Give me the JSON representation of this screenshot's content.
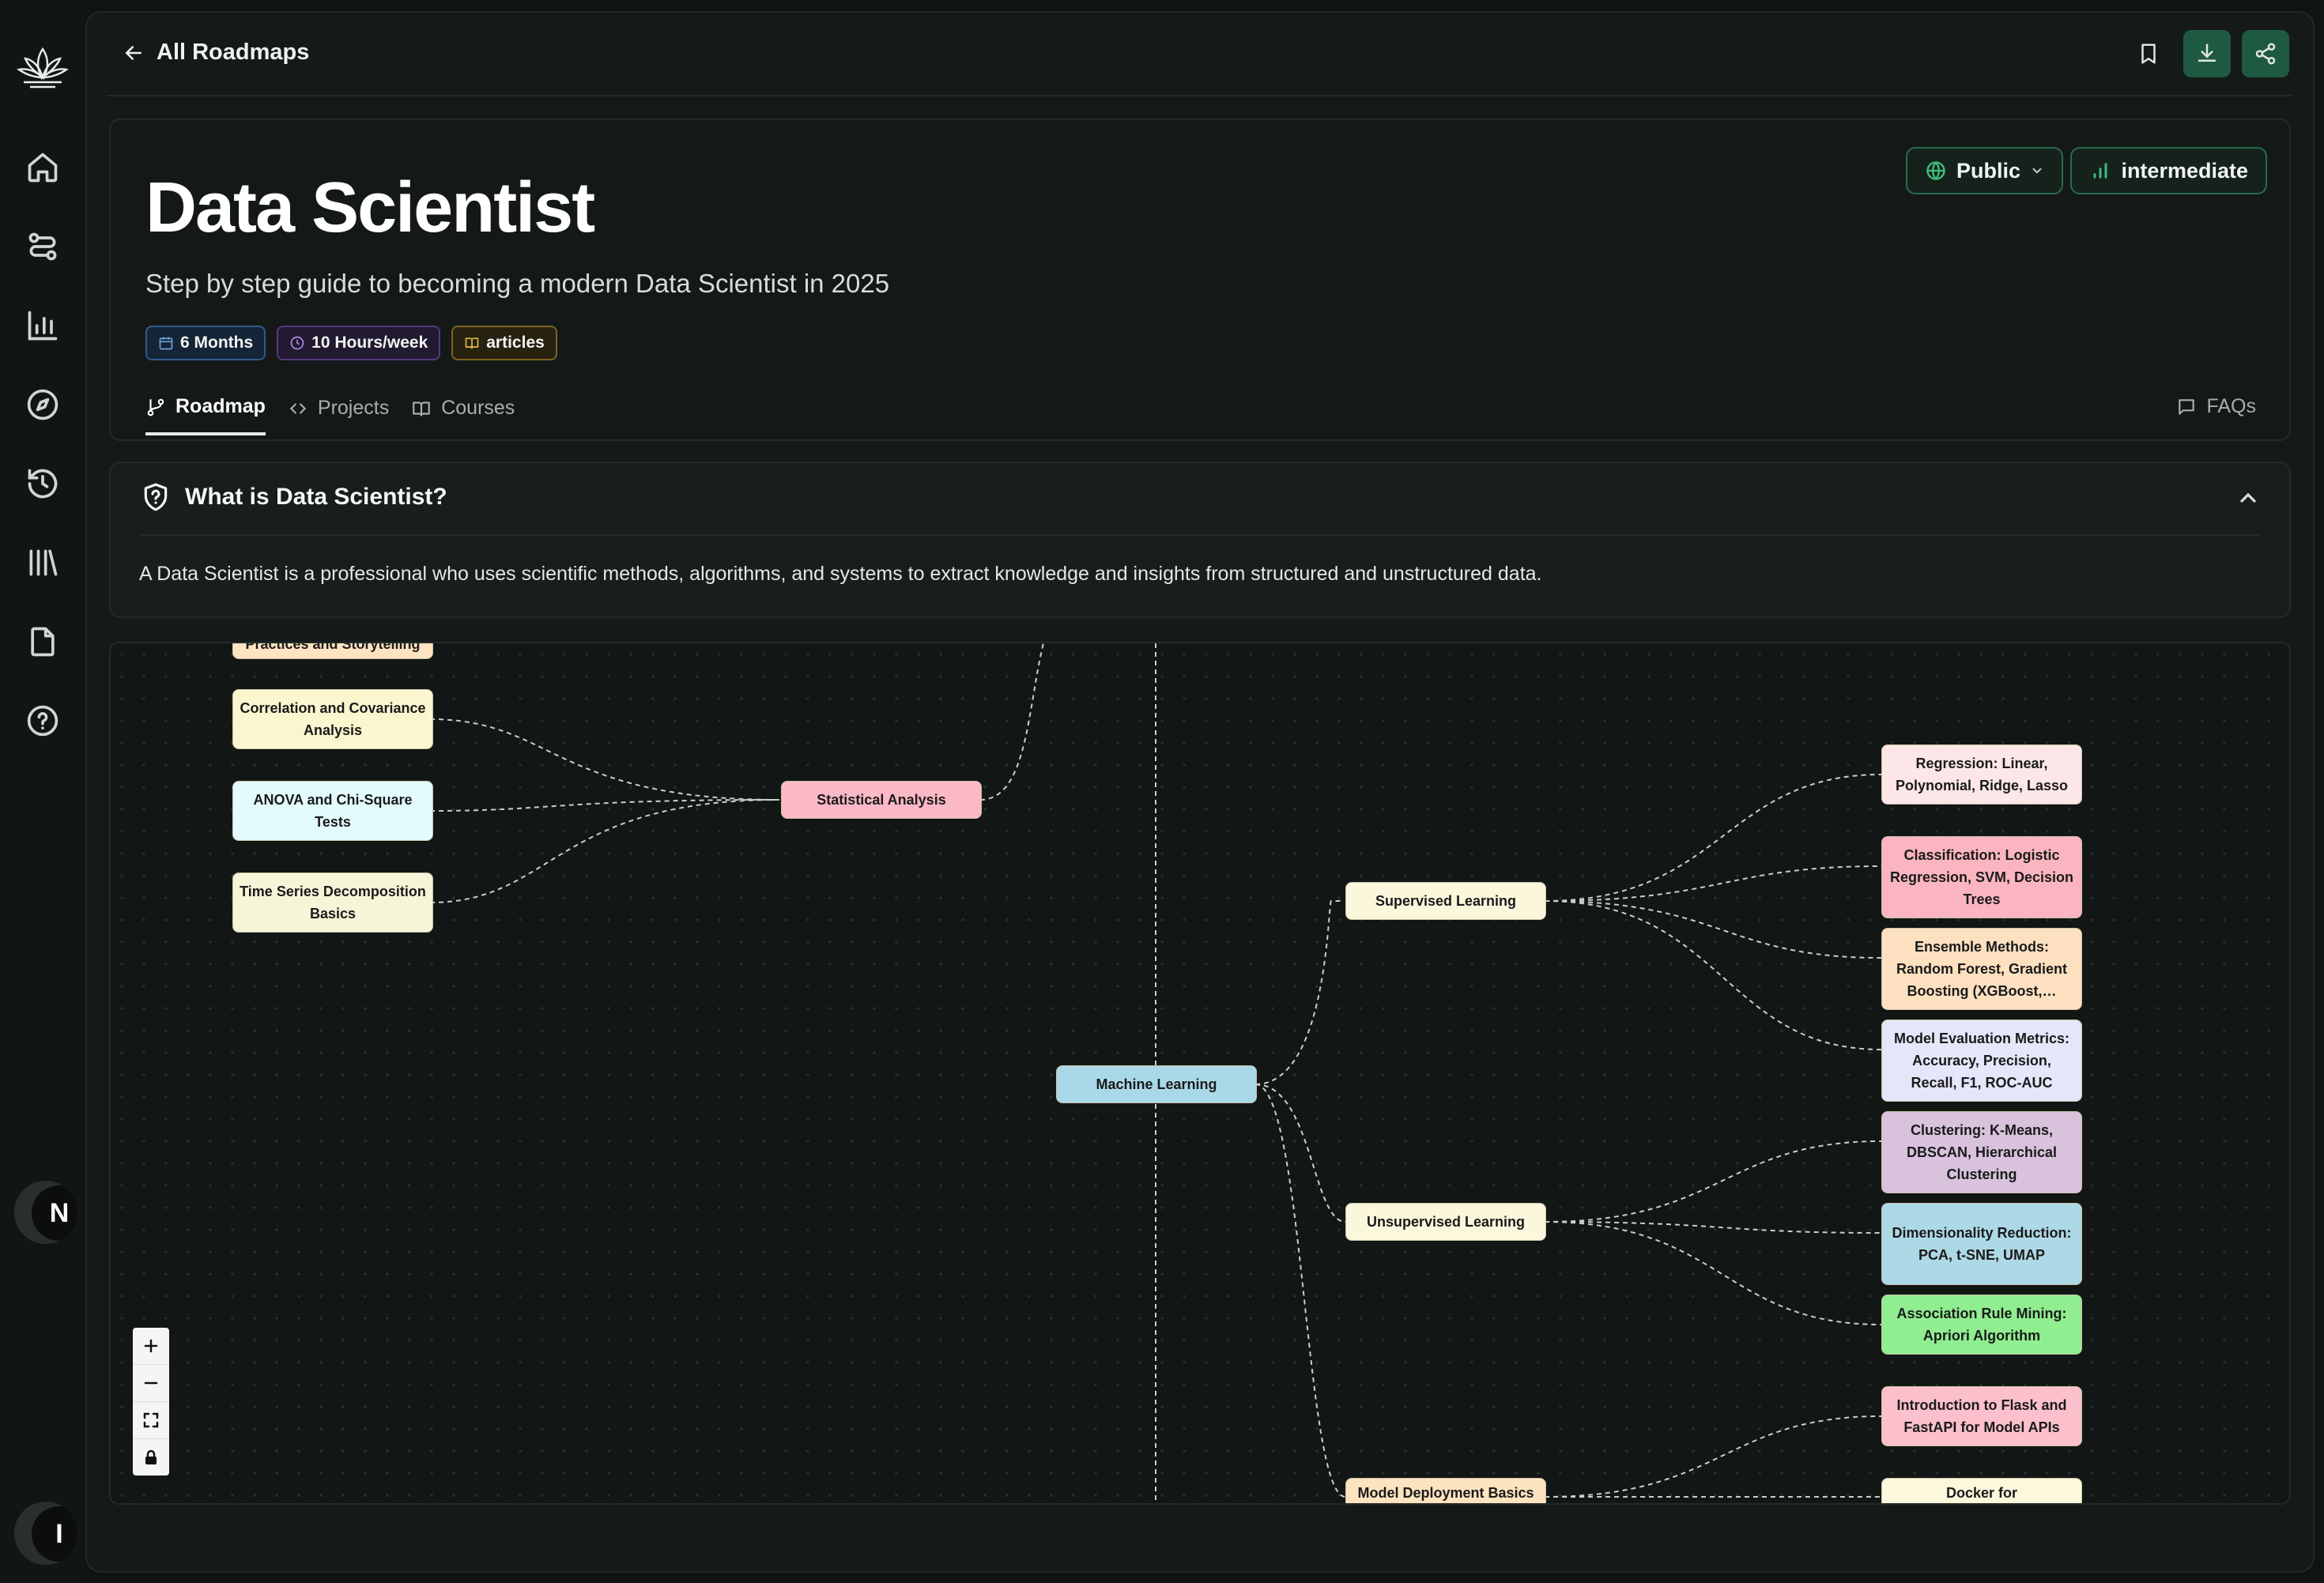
{
  "nav": {
    "back_label": "All Roadmaps",
    "sidebar_icons": [
      "lotus-logo-icon",
      "home-icon",
      "route-icon",
      "bar-chart-icon",
      "compass-icon",
      "history-icon",
      "library-icon",
      "file-icon",
      "help-icon"
    ],
    "avatar_initial_1": "N",
    "avatar_initial_2": "I"
  },
  "header": {
    "title": "Data Scientist",
    "subtitle": "Step by step guide to becoming a modern Data Scientist in 2025",
    "badges": {
      "duration": "6 Months",
      "hours": "10 Hours/week",
      "resource": "articles"
    },
    "visibility": "Public",
    "level": "intermediate"
  },
  "tabs": {
    "roadmap": "Roadmap",
    "projects": "Projects",
    "courses": "Courses",
    "faqs": "FAQs"
  },
  "whatis": {
    "title": "What is Data Scientist?",
    "body": "A Data Scientist is a professional who uses scientific methods, algorithms, and systems to extract knowledge and insights from structured and unstructured data."
  },
  "graph": {
    "nodes": {
      "storytelling": "Practices and Storytelling",
      "correlation": "Correlation and Covariance Analysis",
      "anova": "ANOVA and Chi-Square Tests",
      "timeseries": "Time Series Decomposition Basics",
      "statistical": "Statistical Analysis",
      "ml": "Machine Learning",
      "supervised": "Supervised Learning",
      "unsupervised": "Unsupervised Learning",
      "deployment": "Model Deployment Basics",
      "regression": "Regression: Linear, Polynomial, Ridge, Lasso",
      "classification": "Classification: Logistic Regression, SVM, Decision Trees",
      "ensemble": "Ensemble Methods: Random Forest, Gradient Boosting (XGBoost,…",
      "evaluation": "Model Evaluation Metrics: Accuracy, Precision, Recall, F1, ROC-AUC",
      "clustering": "Clustering: K-Means, DBSCAN, Hierarchical Clustering",
      "dimensionality": "Dimensionality Reduction: PCA, t-SNE, UMAP",
      "association": "Association Rule Mining: Apriori Algorithm",
      "flask": "Introduction to Flask and FastAPI for Model APIs",
      "docker": "Docker for"
    },
    "node_colors": {
      "storytelling": "#fde3bf",
      "correlation": "#fbf6cf",
      "anova": "#e3fbfd",
      "timeseries": "#f7f5d8",
      "statistical": "#fbb8c5",
      "ml": "#a9d9e8",
      "supervised": "#fbf7dd",
      "unsupervised": "#fbf7dd",
      "deployment": "#fde3bf",
      "regression": "#fde6e8",
      "classification": "#fbb5c0",
      "ensemble": "#fde0c0",
      "evaluation": "#e4e6fa",
      "clustering": "#d8c2dc",
      "dimensionality": "#add8e6",
      "association": "#90ee90",
      "flask": "#fbc0cb",
      "docker": "#fbf8dc"
    },
    "accent": "#1e5a42"
  }
}
